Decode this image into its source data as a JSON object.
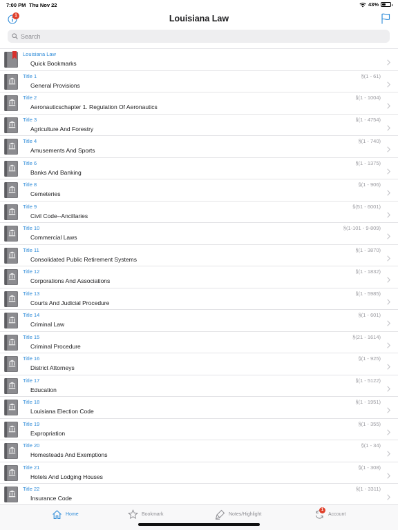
{
  "status_bar": {
    "time": "7:00 PM",
    "date": "Thu Nov 22",
    "battery": "43%",
    "battery_level": 0.43
  },
  "nav": {
    "title": "Louisiana Law",
    "info_badge": "1"
  },
  "search": {
    "placeholder": "Search",
    "value": ""
  },
  "list": [
    {
      "top": "Louisiana Law",
      "name": "Quick Bookmarks",
      "range": "",
      "icon": "bookmark-book-icon"
    },
    {
      "top": "Title 1",
      "name": "General Provisions",
      "range": "§(1 - 61)",
      "icon": "law-book-icon"
    },
    {
      "top": "Title 2",
      "name": "Aeronauticschapter 1. Regulation Of Aeronautics",
      "range": "§(1 - 1004)",
      "icon": "law-book-icon"
    },
    {
      "top": "Title 3",
      "name": "Agriculture And Forestry",
      "range": "§(1 - 4754)",
      "icon": "law-book-icon"
    },
    {
      "top": "Title 4",
      "name": "Amusements And Sports",
      "range": "§(1 - 740)",
      "icon": "law-book-icon"
    },
    {
      "top": "Title 6",
      "name": "Banks And Banking",
      "range": "§(1 - 1375)",
      "icon": "law-book-icon"
    },
    {
      "top": "Title 8",
      "name": "Cemeteries",
      "range": "§(1 - 906)",
      "icon": "law-book-icon"
    },
    {
      "top": "Title 9",
      "name": "Civil Code--Ancillaries",
      "range": "§(51 - 6001)",
      "icon": "law-book-icon"
    },
    {
      "top": "Title 10",
      "name": "Commercial Laws",
      "range": "§(1-101 - 9-809)",
      "icon": "law-book-icon"
    },
    {
      "top": "Title 11",
      "name": "Consolidated Public Retirement Systems",
      "range": "§(1 - 3870)",
      "icon": "law-book-icon"
    },
    {
      "top": "Title 12",
      "name": "Corporations And Associations",
      "range": "§(1 - 1832)",
      "icon": "law-book-icon"
    },
    {
      "top": "Title 13",
      "name": "Courts And Judicial Procedure",
      "range": "§(1 - 5985)",
      "icon": "law-book-icon"
    },
    {
      "top": "Title 14",
      "name": "Criminal Law",
      "range": "§(1 - 601)",
      "icon": "law-book-icon"
    },
    {
      "top": "Title 15",
      "name": "Criminal Procedure",
      "range": "§(21 - 1614)",
      "icon": "law-book-icon"
    },
    {
      "top": "Title 16",
      "name": "District Attorneys",
      "range": "§(1 - 925)",
      "icon": "law-book-icon"
    },
    {
      "top": "Title 17",
      "name": "Education",
      "range": "§(1 - 5122)",
      "icon": "law-book-icon"
    },
    {
      "top": "Title 18",
      "name": "Louisiana Election Code",
      "range": "§(1 - 1951)",
      "icon": "law-book-icon"
    },
    {
      "top": "Title 19",
      "name": "Expropriation",
      "range": "§(1 - 355)",
      "icon": "law-book-icon"
    },
    {
      "top": "Title 20",
      "name": "Homesteads And Exemptions",
      "range": "§(1 - 34)",
      "icon": "law-book-icon"
    },
    {
      "top": "Title 21",
      "name": "Hotels And Lodging Houses",
      "range": "§(1 - 308)",
      "icon": "law-book-icon"
    },
    {
      "top": "Title 22",
      "name": "Insurance Code",
      "range": "§(1 - 3311)",
      "icon": "law-book-icon"
    }
  ],
  "tabs": [
    {
      "label": "Home",
      "icon": "home-icon",
      "active": true
    },
    {
      "label": "Bookmark",
      "icon": "star-icon",
      "active": false
    },
    {
      "label": "Notes/Highlight",
      "icon": "highlighter-icon",
      "active": false
    },
    {
      "label": "Account",
      "icon": "sync-icon",
      "active": false,
      "badge": "1"
    }
  ],
  "colors": {
    "accent": "#2e8bd8",
    "badge": "#e0412c",
    "bookmark_ribbon": "#d9302c",
    "book_cover": "#7a7a7e"
  }
}
